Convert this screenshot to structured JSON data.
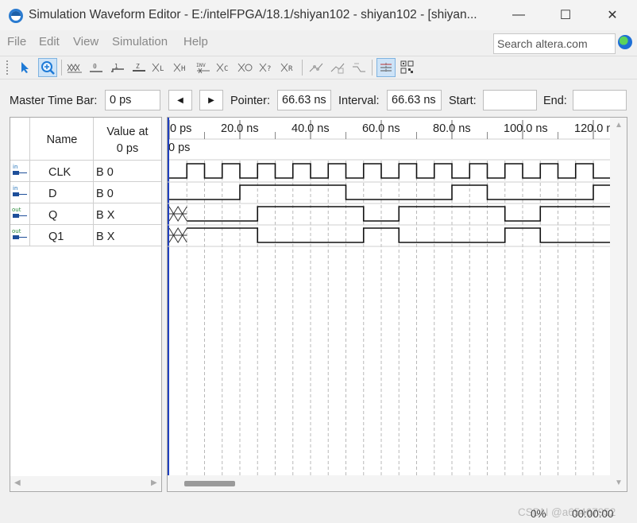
{
  "window": {
    "title": "Simulation Waveform Editor - E:/intelFPGA/18.1/shiyan102 - shiyan102 - [shiyan...",
    "minimize": "—",
    "maximize": "☐",
    "close": "✕"
  },
  "menu": [
    "File",
    "Edit",
    "View",
    "Simulation",
    "Help"
  ],
  "search": {
    "placeholder": "Search altera.com"
  },
  "toolbar": {
    "icons": [
      "pointer-tool-icon",
      "zoom-tool-icon",
      "force-unknown-icon",
      "force-low-icon",
      "force-high-icon",
      "force-high-impedance-icon",
      "force-weak-low-icon",
      "force-weak-high-icon",
      "invert-icon",
      "count-value-icon",
      "overwrite-clock-icon",
      "random-values-icon",
      "arbitrary-value-icon",
      "snap-to-grid-icon",
      "group-icon",
      "ungroup-icon",
      "grid-icon",
      "match-icon"
    ]
  },
  "timebar": {
    "master_label": "Master Time Bar:",
    "master_value": "0 ps",
    "pointer_label": "Pointer:",
    "pointer_value": "66.63 ns",
    "interval_label": "Interval:",
    "interval_value": "66.63 ns",
    "start_label": "Start:",
    "start_value": "",
    "end_label": "End:",
    "end_value": ""
  },
  "signals_header": {
    "name": "Name",
    "value_at_line1": "Value at",
    "value_at_line2": "0 ps"
  },
  "signals": [
    {
      "pin": "in",
      "name": "CLK",
      "value": "B 0"
    },
    {
      "pin": "in",
      "name": "D",
      "value": "B 0"
    },
    {
      "pin": "out",
      "name": "Q",
      "value": "B X"
    },
    {
      "pin": "out",
      "name": "Q1",
      "value": "B X"
    }
  ],
  "timeline": {
    "ticks": [
      "0 ps",
      "20.0 ns",
      "40.0 ns",
      "60.0 ns",
      "80.0 ns",
      "100.0 ns",
      "120.0 n"
    ],
    "cursor_label": "0 ps",
    "range_ns": [
      0,
      125
    ],
    "clock_period_ns": 10
  },
  "waveforms": {
    "CLK": {
      "type": "clock",
      "period_ns": 10,
      "start": 0
    },
    "D": {
      "type": "edges",
      "initial": 0,
      "toggles_ns": [
        20,
        50,
        80,
        90,
        120
      ]
    },
    "Q": {
      "type": "edges",
      "initial": "X",
      "unknown_until_ns": 5,
      "init_after_x": 0,
      "toggles_ns": [
        25,
        55,
        65,
        95,
        105
      ]
    },
    "Q1": {
      "type": "edges",
      "initial": "X",
      "unknown_until_ns": 5,
      "init_after_x": 1,
      "toggles_ns": [
        25,
        55,
        65,
        95,
        105
      ]
    }
  },
  "status": {
    "watermark": "CSDN @a65467952",
    "progress": "0%",
    "elapsed": "00:00:00"
  }
}
